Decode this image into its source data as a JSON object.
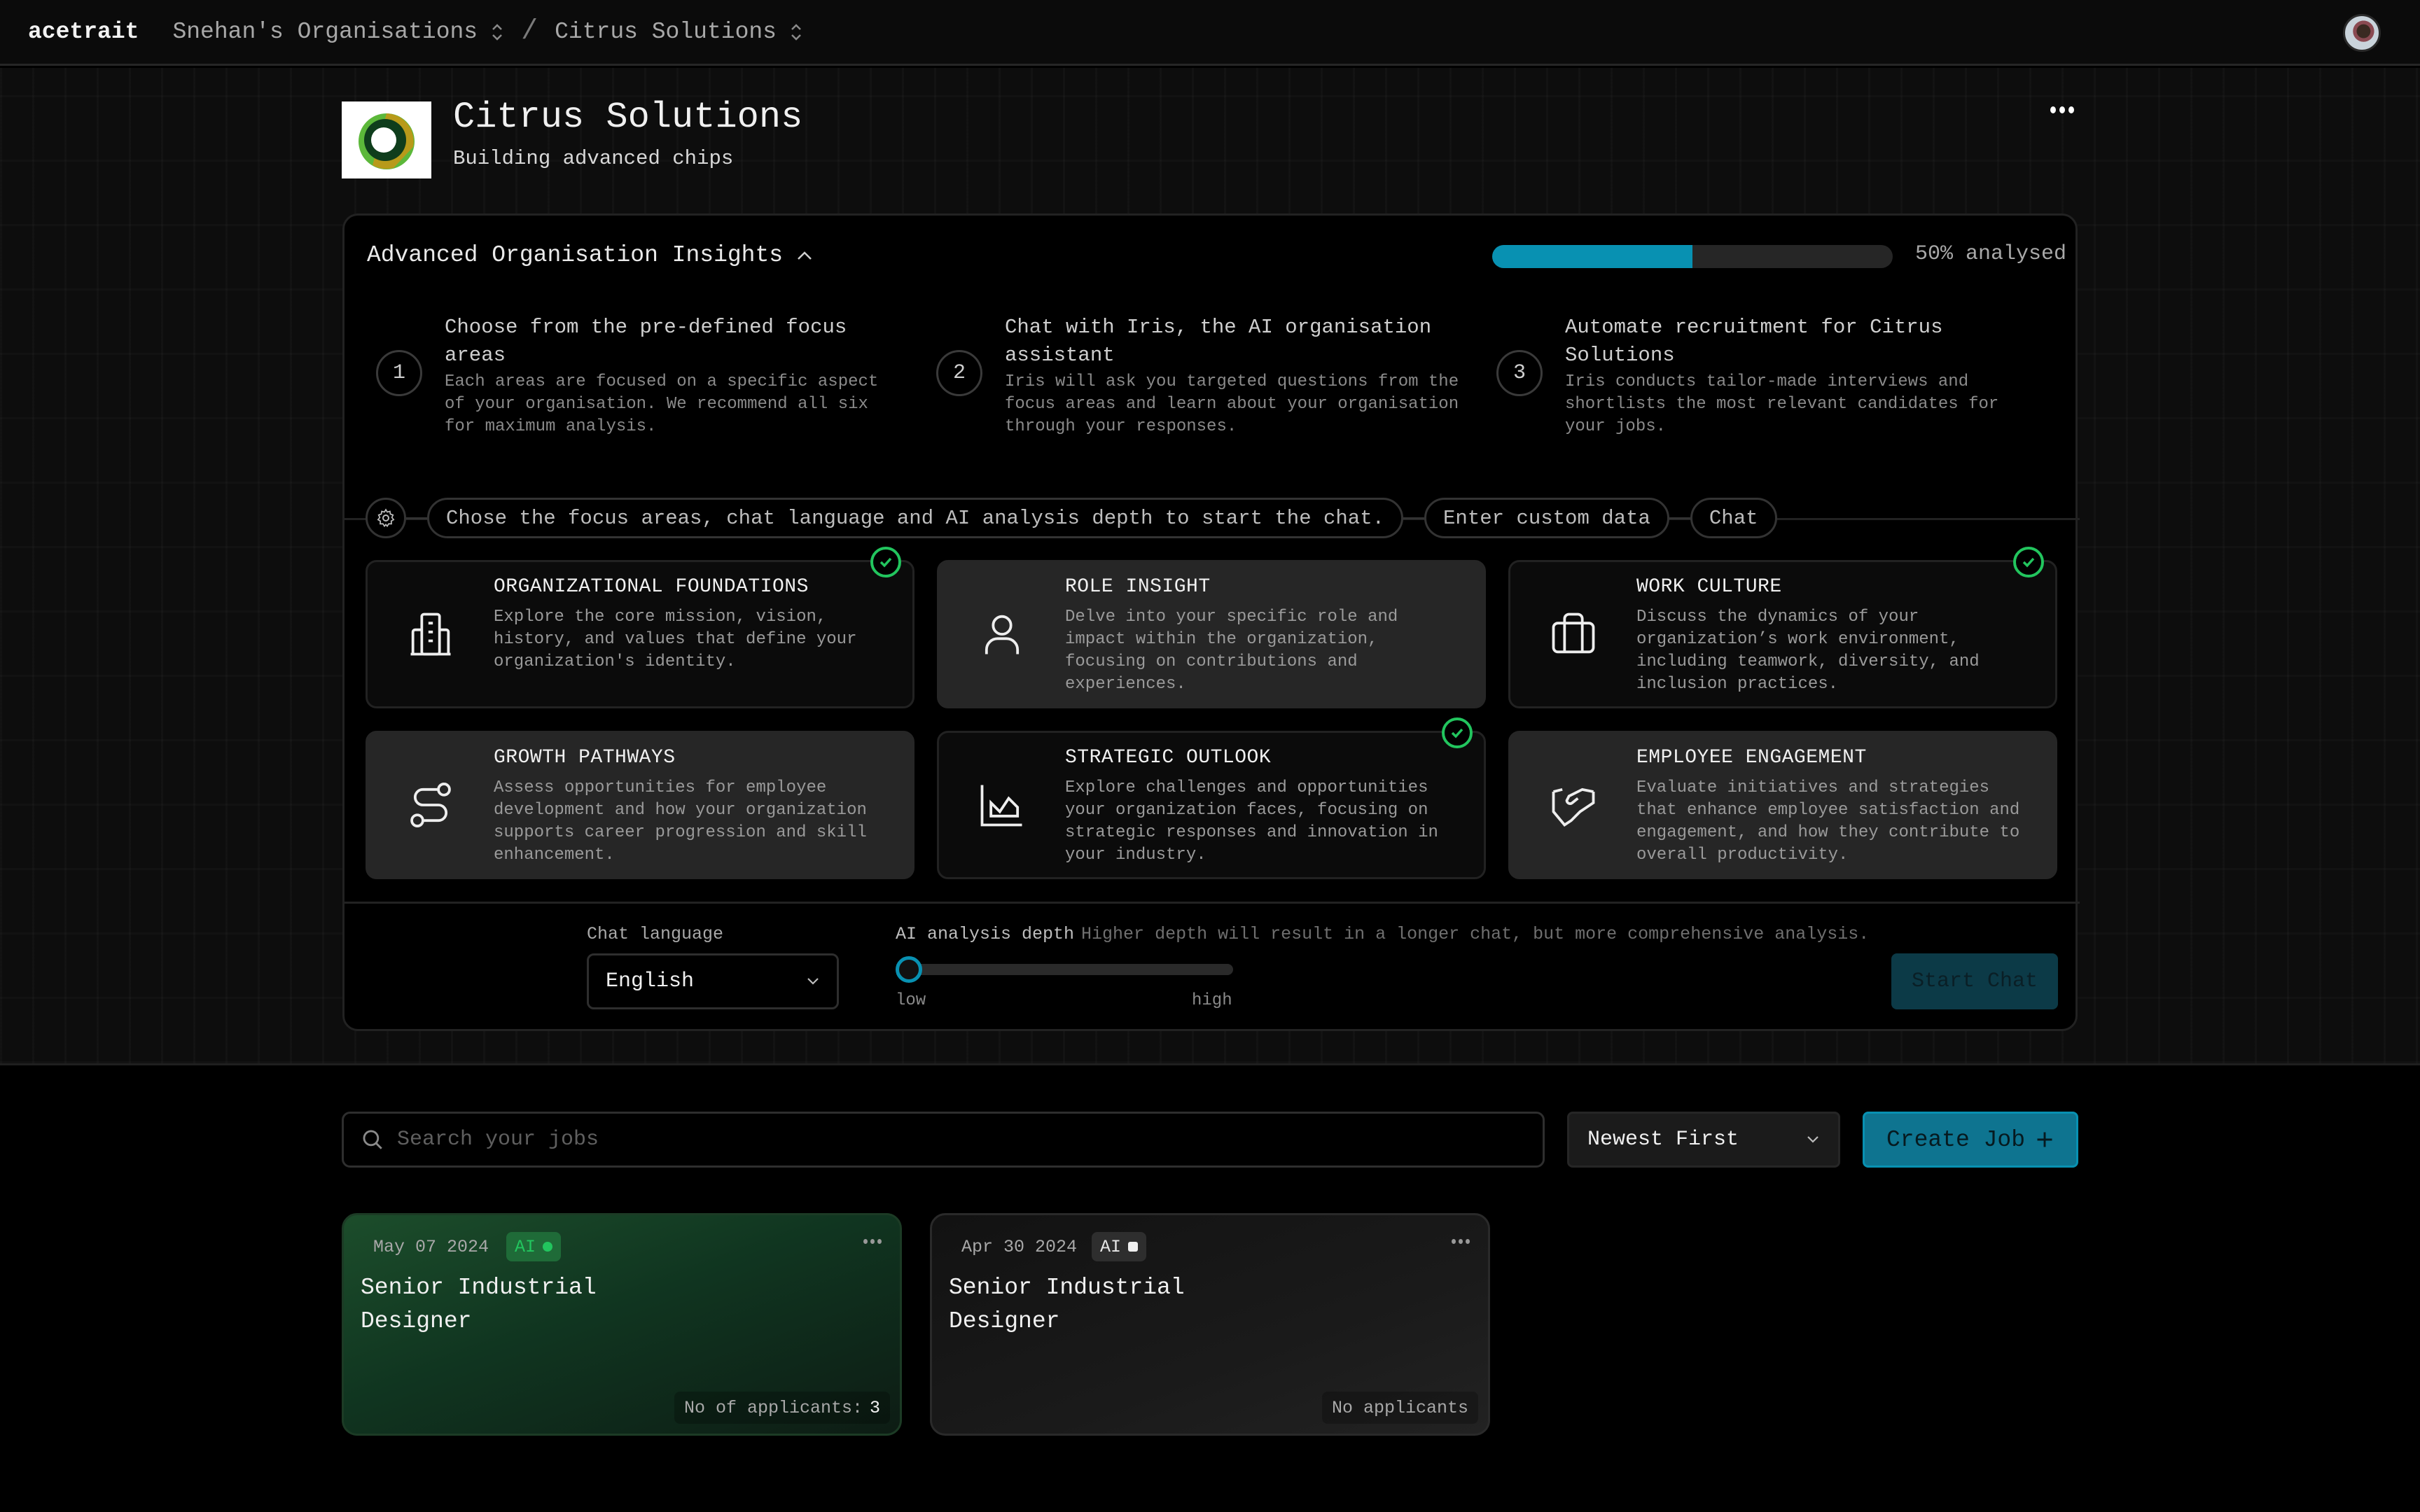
{
  "topbar": {
    "brand": "acetrait",
    "breadcrumbs": [
      {
        "label": "Snehan's Organisations"
      },
      {
        "label": "Citrus Solutions"
      }
    ],
    "separator": "/"
  },
  "org": {
    "name": "Citrus Solutions",
    "tagline": "Building advanced chips"
  },
  "insights": {
    "title": "Advanced Organisation Insights",
    "progress_percent": 50,
    "progress_label": "50% analysed",
    "steps": [
      {
        "num": "1",
        "title": "Choose from the pre-defined focus areas",
        "desc": "Each areas are focused on a specific aspect of your organisation. We recommend all six for maximum analysis."
      },
      {
        "num": "2",
        "title": "Chat with Iris, the AI organisation assistant",
        "desc": "Iris will ask you targeted questions from the focus areas and learn about your organisation through your responses."
      },
      {
        "num": "3",
        "title": "Automate recruitment for Citrus Solutions",
        "desc": "Iris conducts tailor-made interviews and shortlists the most relevant candidates for your jobs."
      }
    ],
    "flow": {
      "instruction": "Chose the focus areas, chat language and AI analysis depth to start the chat.",
      "custom_data": "Enter custom data",
      "chat": "Chat"
    },
    "focus_areas": [
      {
        "title": "ORGANIZATIONAL FOUNDATIONS",
        "desc": "Explore the core mission, vision, history, and values that define your organization's identity.",
        "icon": "building-icon",
        "selected": true
      },
      {
        "title": "ROLE INSIGHT",
        "desc": "Delve into your specific role and impact within the organization, focusing on contributions and experiences.",
        "icon": "user-icon",
        "selected": false
      },
      {
        "title": "WORK CULTURE",
        "desc": "Discuss the dynamics of your organization’s work environment, including teamwork, diversity, and inclusion practices.",
        "icon": "briefcase-icon",
        "selected": true
      },
      {
        "title": "GROWTH PATHWAYS",
        "desc": "Assess opportunities for employee development and how your organization supports career progression and skill enhancement.",
        "icon": "route-icon",
        "selected": false
      },
      {
        "title": "STRATEGIC OUTLOOK",
        "desc": "Explore challenges and opportunities your organization faces, focusing on strategic responses and innovation in your industry.",
        "icon": "chart-icon",
        "selected": true
      },
      {
        "title": "EMPLOYEE ENGAGEMENT",
        "desc": "Evaluate initiatives and strategies that enhance employee satisfaction and engagement, and how they contribute to overall productivity.",
        "icon": "handshake-icon",
        "selected": false
      }
    ],
    "chat_language": {
      "label": "Chat language",
      "value": "English"
    },
    "analysis_depth": {
      "label": "AI analysis depth",
      "hint": "Higher depth will result in a longer chat, but more comprehensive analysis.",
      "value_fraction": 0,
      "low": "low",
      "high": "high"
    },
    "start_chat": "Start Chat"
  },
  "jobs": {
    "search_placeholder": "Search your jobs",
    "sort_value": "Newest First",
    "create_label": "Create Job",
    "items": [
      {
        "date": "May 07 2024",
        "ai": "AI",
        "title": "Senior Industrial Designer",
        "applicants_label": "No of applicants:",
        "applicants_count": "3"
      },
      {
        "date": "Apr 30 2024",
        "ai": "AI",
        "title": "Senior Industrial Designer",
        "applicants_label": "No applicants",
        "applicants_count": ""
      }
    ]
  },
  "colors": {
    "accent": "#0891b2",
    "success": "#22c55e",
    "start_chat_bg": "#0c3a47"
  }
}
